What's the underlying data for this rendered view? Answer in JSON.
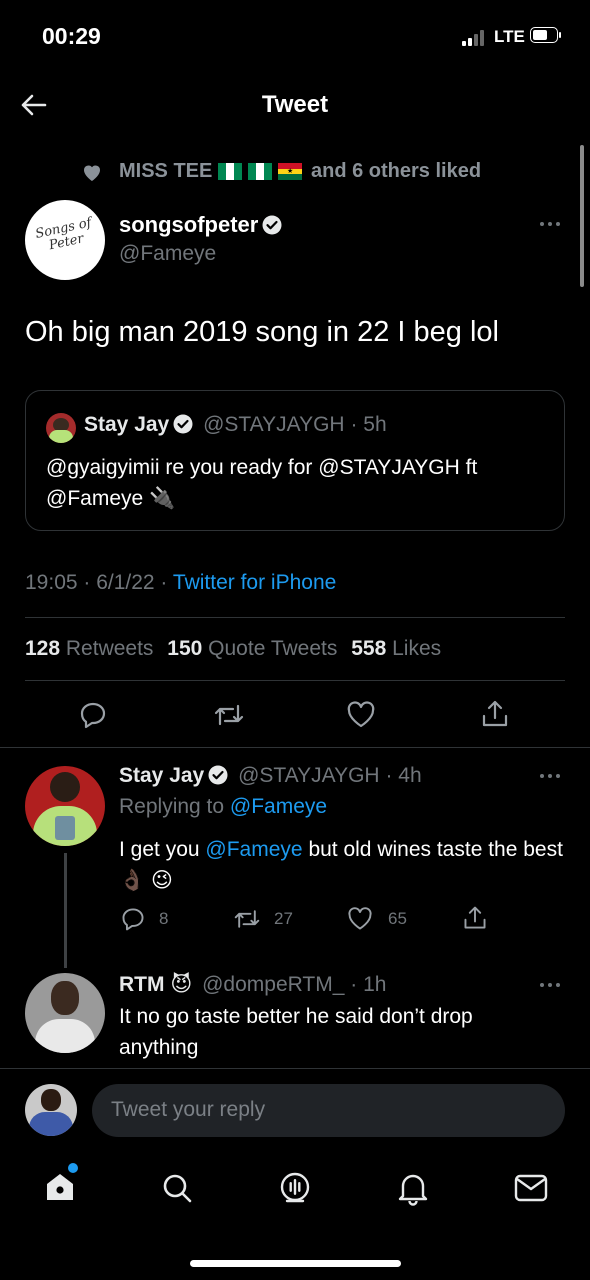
{
  "status_bar": {
    "time": "00:29",
    "network": "LTE"
  },
  "header": {
    "title": "Tweet"
  },
  "social_context": {
    "prefix": "MISS TEE",
    "suffix": "and 6 others liked"
  },
  "tweet": {
    "display_name": "songsofpeter",
    "handle": "@Fameye",
    "avatar_text": "Songs of Peter",
    "text": "Oh big man 2019 song in 22 I beg lol",
    "quoted": {
      "display_name": "Stay Jay",
      "handle": "@STAYJAYGH",
      "time": "· 5h",
      "text_mention1": "@gyaigyimii",
      "text_mid": " re you ready for ",
      "text_mention2": "@STAYJAYGH",
      "text_ft": " ft",
      "text_mention3": "@Fameye",
      "emoji": "🔌"
    },
    "timestamp": "19:05 · 6/1/22 ·",
    "source": "Twitter for iPhone",
    "stats": {
      "retweets_count": "128",
      "retweets_label": "Retweets",
      "quotes_count": "150",
      "quotes_label": "Quote Tweets",
      "likes_count": "558",
      "likes_label": "Likes"
    }
  },
  "replies": [
    {
      "display_name": "Stay Jay",
      "handle": "@STAYJAYGH",
      "time": "· 4h",
      "replying_prefix": "Replying to",
      "replying_to": "@Fameye",
      "text_a": "I get you",
      "mention": "@Fameye",
      "text_b": "but old wines taste the best",
      "emoji": "👌🏿 😉",
      "reply_count": "8",
      "retweet_count": "27",
      "like_count": "65"
    },
    {
      "display_name": "RTM",
      "emoji": "😈",
      "handle": "@dompeRTM_",
      "time": "· 1h",
      "text": "It no go taste better he said don’t drop anything"
    }
  ],
  "composer": {
    "placeholder": "Tweet your reply"
  },
  "colors": {
    "accent": "#1d9bf0",
    "muted": "#71767b",
    "background": "#000000"
  }
}
